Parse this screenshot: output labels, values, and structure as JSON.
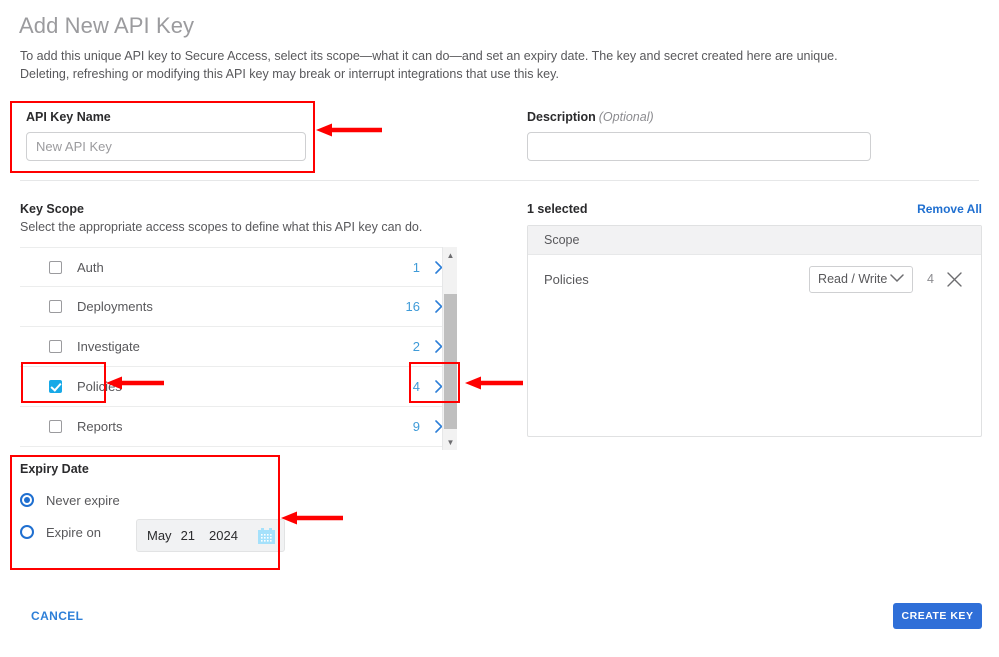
{
  "page": {
    "title": "Add New API Key",
    "description_line1": "To add this unique API key to Secure Access, select its scope—what it can do—and set an expiry date. The key and secret created here are unique.",
    "description_line2": "Deleting, refreshing or modifying this API key may break or interrupt integrations that use this key."
  },
  "api_key_name": {
    "label": "API Key Name",
    "placeholder": "New API Key",
    "value": ""
  },
  "description": {
    "label": "Description",
    "optional": "(Optional)",
    "placeholder": "",
    "value": ""
  },
  "key_scope": {
    "heading": "Key Scope",
    "subheading": "Select the appropriate access scopes to define what this API key can do.",
    "items": [
      {
        "label": "Auth",
        "count": "1",
        "checked": false
      },
      {
        "label": "Deployments",
        "count": "16",
        "checked": false
      },
      {
        "label": "Investigate",
        "count": "2",
        "checked": false
      },
      {
        "label": "Policies",
        "count": "4",
        "checked": true
      },
      {
        "label": "Reports",
        "count": "9",
        "checked": false
      }
    ]
  },
  "selected": {
    "count_label": "1 selected",
    "remove_all_label": "Remove All",
    "column_header": "Scope",
    "rows": [
      {
        "name": "Policies",
        "permission": "Read / Write",
        "count": "4"
      }
    ],
    "permission_options": [
      "Read / Write"
    ]
  },
  "expiry": {
    "title": "Expiry Date",
    "never_label": "Never expire",
    "expire_on_label": "Expire on",
    "selected_option": "Never expire",
    "date": {
      "month": "May",
      "day": "21",
      "year": "2024"
    }
  },
  "footer": {
    "cancel_label": "CANCEL",
    "create_label": "CREATE KEY"
  },
  "colors": {
    "accent_blue": "#2f6fd8",
    "link_blue": "#2d7fd8",
    "checkbox_blue": "#17a9e7",
    "count_blue": "#3f9bd8",
    "annotation_red": "#ff0000",
    "calendar_icon_blue": "#a5e1fb"
  }
}
